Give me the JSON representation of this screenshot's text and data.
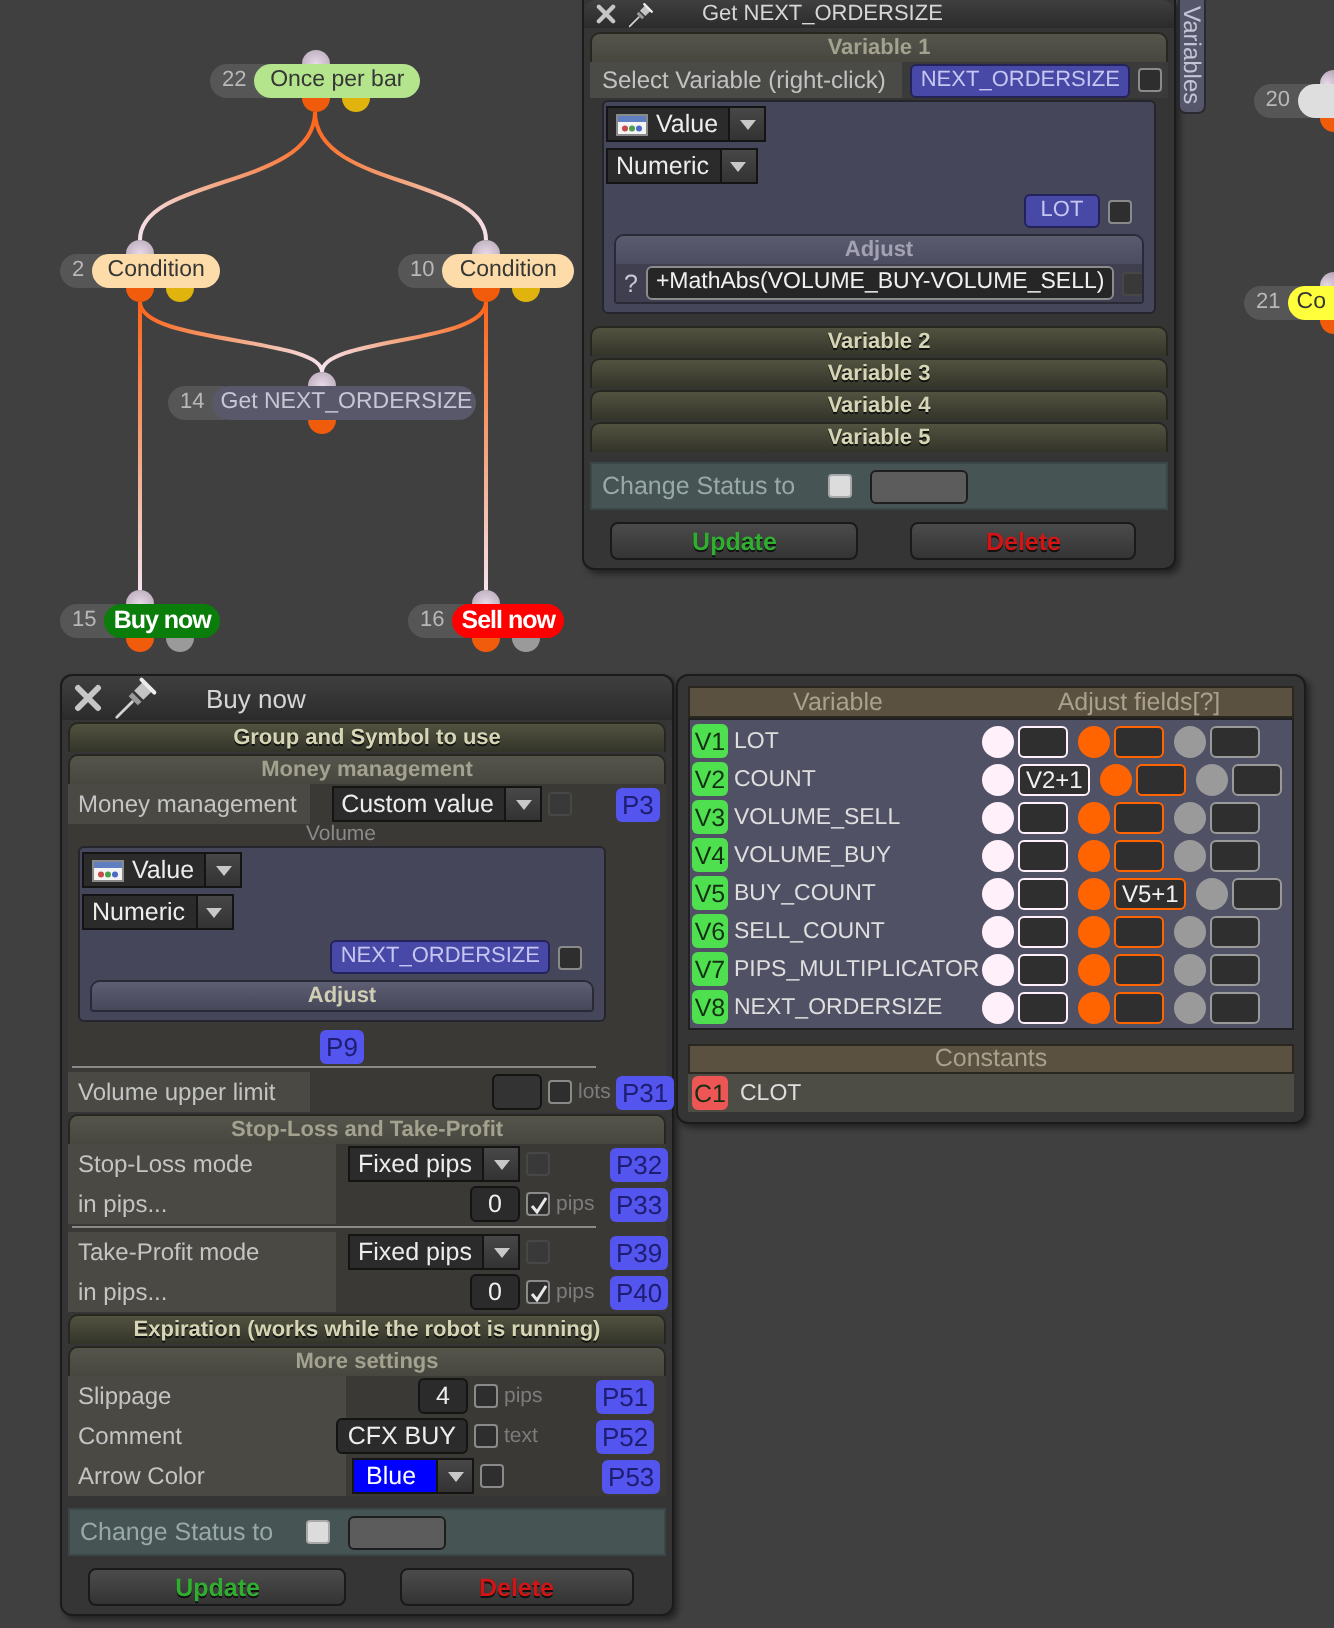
{
  "canvas": {
    "nodes": [
      {
        "number": "22",
        "label": "Once per bar",
        "kind": "block",
        "color": "#b4e48c",
        "outputs": [
          {
            "color": "#f05b0c"
          },
          {
            "color": "#e0b40c"
          }
        ]
      },
      {
        "number": "2",
        "label": "Condition",
        "kind": "block",
        "color": "#fddcaa",
        "outputs": [
          {
            "color": "#f05b0c"
          },
          {
            "color": "#e0b40c"
          }
        ]
      },
      {
        "number": "10",
        "label": "Condition",
        "kind": "block",
        "color": "#fddcaa",
        "outputs": [
          {
            "color": "#f05b0c"
          },
          {
            "color": "#e0b40c"
          }
        ]
      },
      {
        "number": "14",
        "label": "Get NEXT_ORDERSIZE",
        "kind": "block",
        "color": "#58586a",
        "outputs": [
          {
            "color": "#f05b0c"
          }
        ]
      },
      {
        "number": "15",
        "label": "Buy now",
        "kind": "trade",
        "color": "#0b7d0b",
        "outputs": [
          {
            "color": "#f05b0c"
          },
          {
            "color": "#9a9a9a"
          }
        ]
      },
      {
        "number": "16",
        "label": "Sell now",
        "kind": "trade",
        "color": "#ff0000",
        "outputs": [
          {
            "color": "#f05b0c"
          },
          {
            "color": "#9a9a9a"
          }
        ]
      },
      {
        "number": "20",
        "kind": "block",
        "color": "#dedede",
        "outputs": [
          {
            "color": "#f05b0c"
          }
        ]
      },
      {
        "number": "21",
        "label": "Co",
        "kind": "block",
        "color": "#ffff3c",
        "outputs": [
          {
            "color": "#f05b0c"
          }
        ]
      }
    ]
  },
  "side_tab": {
    "label": "Variables"
  },
  "variable_window": {
    "title": "Get NEXT_ORDERSIZE",
    "sections": [
      {
        "title": "Variable 1",
        "expanded": true,
        "select_label": "Select Variable (right-click)",
        "target": "NEXT_ORDERSIZE",
        "target_checkbox": {
          "checked": false,
          "disabled": false
        },
        "editor": {
          "source": "Value",
          "type": "Numeric",
          "variable": "LOT",
          "checkbox": {
            "checked": false,
            "disabled": false
          },
          "adjust": {
            "title": "Adjust",
            "expanded": true,
            "help": "?",
            "value": "+MathAbs(VOLUME_BUY-VOLUME_SELL)",
            "checkbox": {
              "checked": false,
              "disabled": true
            }
          }
        }
      },
      {
        "title": "Variable 2",
        "expanded": false
      },
      {
        "title": "Variable 3",
        "expanded": false
      },
      {
        "title": "Variable 4",
        "expanded": false
      },
      {
        "title": "Variable 5",
        "expanded": false
      }
    ],
    "status": {
      "label": "Change Status to",
      "checked": false
    },
    "buttons": [
      {
        "label": "Update",
        "kind": "update"
      },
      {
        "label": "Delete",
        "kind": "delete"
      }
    ]
  },
  "order_window": {
    "title": "Buy now",
    "sections": [
      {
        "title": "Group and Symbol to use",
        "expanded": false
      },
      {
        "title": "Money management",
        "expanded": true,
        "rows": [
          {
            "kind": "dropdown",
            "label": "Money management",
            "value": "Custom value",
            "checkbox": {
              "checked": false,
              "disabled": true
            },
            "param": "P3"
          },
          {
            "kind": "editor",
            "caption": "Volume",
            "editor": {
              "source": "Value",
              "type": "Numeric",
              "variable": "NEXT_ORDERSIZE",
              "checkbox": {
                "checked": false,
                "disabled": false
              },
              "adjust": {
                "title": "Adjust",
                "expanded": false
              }
            },
            "param": "P9"
          },
          {
            "kind": "divider"
          },
          {
            "kind": "input",
            "label": "Volume upper limit",
            "checkbox": {
              "checked": false,
              "disabled": false
            },
            "unit": "lots",
            "param": "P31"
          }
        ]
      },
      {
        "title": "Stop-Loss and Take-Profit",
        "expanded": true,
        "rows": [
          {
            "kind": "dropdown",
            "label": "Stop-Loss mode",
            "value": "Fixed pips",
            "checkbox": {
              "checked": false,
              "disabled": true
            },
            "param": "P32"
          },
          {
            "kind": "input",
            "label": "in pips...",
            "value": "0",
            "checkbox": {
              "checked": true,
              "disabled": false
            },
            "unit": "pips",
            "param": "P33"
          },
          {
            "kind": "divider"
          },
          {
            "kind": "dropdown",
            "label": "Take-Profit mode",
            "value": "Fixed pips",
            "checkbox": {
              "checked": false,
              "disabled": true
            },
            "param": "P39"
          },
          {
            "kind": "input",
            "label": "in pips...",
            "value": "0",
            "checkbox": {
              "checked": true,
              "disabled": false
            },
            "unit": "pips",
            "param": "P40"
          }
        ]
      },
      {
        "title": "Expiration (works while the robot is running)",
        "expanded": false
      },
      {
        "title": "More settings",
        "expanded": true,
        "rows": [
          {
            "kind": "input",
            "label": "Slippage",
            "value": "4",
            "checkbox": {
              "checked": false,
              "disabled": false
            },
            "unit": "pips",
            "param": "P51"
          },
          {
            "kind": "input",
            "label": "Comment",
            "value": "CFX BUY",
            "checkbox": {
              "checked": false,
              "disabled": false
            },
            "unit": "text",
            "param": "P52"
          },
          {
            "kind": "color_dropdown",
            "label": "Arrow Color",
            "value": "Blue",
            "color": "#0000ff",
            "checkbox": {
              "checked": false,
              "disabled": false
            },
            "param": "P53"
          }
        ]
      }
    ],
    "status": {
      "label": "Change Status to",
      "checked": false
    },
    "buttons": [
      {
        "label": "Update",
        "kind": "update"
      },
      {
        "label": "Delete",
        "kind": "delete"
      }
    ]
  },
  "variables_window": {
    "columns": [
      "Variable",
      "Adjust fields[?]"
    ],
    "rows": [
      {
        "badge": "V1",
        "name": "LOT",
        "color": "#4fe04f",
        "fields": [
          {
            "color": "#fff0fa"
          },
          {
            "color": "#ff6400"
          },
          {
            "color": "#9a9a9a"
          }
        ]
      },
      {
        "badge": "V2",
        "name": "COUNT",
        "color": "#4fe04f",
        "fields": [
          {
            "color": "#fff0fa",
            "value": "V2+1"
          },
          {
            "color": "#ff6400"
          },
          {
            "color": "#9a9a9a"
          }
        ]
      },
      {
        "badge": "V3",
        "name": "VOLUME_SELL",
        "color": "#4fe04f",
        "fields": [
          {
            "color": "#fff0fa"
          },
          {
            "color": "#ff6400"
          },
          {
            "color": "#9a9a9a"
          }
        ]
      },
      {
        "badge": "V4",
        "name": "VOLUME_BUY",
        "color": "#4fe04f",
        "fields": [
          {
            "color": "#fff0fa"
          },
          {
            "color": "#ff6400"
          },
          {
            "color": "#9a9a9a"
          }
        ]
      },
      {
        "badge": "V5",
        "name": "BUY_COUNT",
        "color": "#4fe04f",
        "fields": [
          {
            "color": "#fff0fa"
          },
          {
            "color": "#ff6400",
            "value": "V5+1"
          },
          {
            "color": "#9a9a9a"
          }
        ]
      },
      {
        "badge": "V6",
        "name": "SELL_COUNT",
        "color": "#4fe04f",
        "fields": [
          {
            "color": "#fff0fa"
          },
          {
            "color": "#ff6400"
          },
          {
            "color": "#9a9a9a"
          }
        ]
      },
      {
        "badge": "V7",
        "name": "PIPS_MULTIPLICATOR",
        "color": "#4fe04f",
        "fields": [
          {
            "color": "#fff0fa"
          },
          {
            "color": "#ff6400"
          },
          {
            "color": "#9a9a9a"
          }
        ]
      },
      {
        "badge": "V8",
        "name": "NEXT_ORDERSIZE",
        "color": "#4fe04f",
        "fields": [
          {
            "color": "#fff0fa"
          },
          {
            "color": "#ff6400"
          },
          {
            "color": "#9a9a9a"
          }
        ]
      }
    ],
    "constants_title": "Constants",
    "constants": [
      {
        "badge": "C1",
        "name": "CLOT",
        "color": "#ee5656"
      }
    ]
  }
}
